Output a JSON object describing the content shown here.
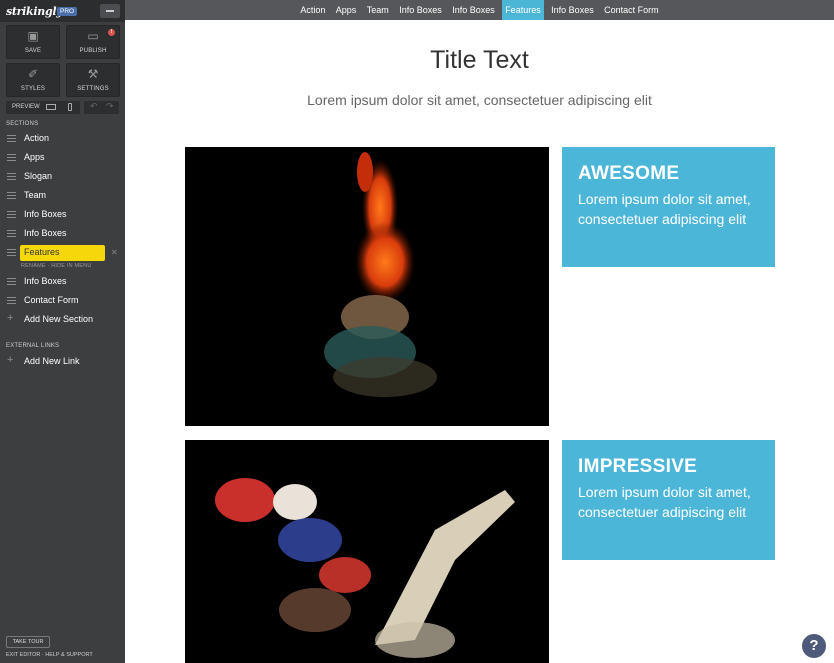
{
  "app": {
    "logo": "strikingly",
    "badge": "PRO"
  },
  "toolbar": {
    "save": "SAVE",
    "publish": "PUBLISH",
    "publish_badge": "!",
    "styles": "STYLES",
    "settings": "SETTINGS",
    "preview": "PREVIEW"
  },
  "sidebar": {
    "sections_heading": "SECTIONS",
    "items": [
      {
        "label": "Action"
      },
      {
        "label": "Apps"
      },
      {
        "label": "Slogan"
      },
      {
        "label": "Team"
      },
      {
        "label": "Info Boxes"
      },
      {
        "label": "Info Boxes"
      },
      {
        "label": "Features",
        "active": true
      },
      {
        "label": "Info Boxes"
      },
      {
        "label": "Contact Form"
      }
    ],
    "item_actions": "RENAME  ·  HIDE IN MENU",
    "add_section": "Add New Section",
    "external_heading": "EXTERNAL LINKS",
    "add_link": "Add New Link",
    "tour": "TAKE TOUR",
    "exit": "EXIT EDITOR · HELP & SUPPORT"
  },
  "topnav": {
    "links": [
      "Action",
      "Apps",
      "Team",
      "Info Boxes",
      "Info Boxes",
      "Features",
      "Info Boxes",
      "Contact Form"
    ],
    "active": "Features"
  },
  "content": {
    "title": "Title Text",
    "subtitle": "Lorem ipsum dolor sit amet, consectetuer adipiscing elit",
    "features": [
      {
        "title": "AWESOME",
        "text": "Lorem ipsum dolor sit amet, consectetuer adipiscing elit"
      },
      {
        "title": "IMPRESSIVE",
        "text": "Lorem ipsum dolor sit amet, consectetuer adipiscing elit"
      }
    ]
  },
  "help": {
    "label": "?"
  },
  "colors": {
    "accent": "#4cb6d9",
    "active_section": "#f5d80b",
    "sidebar": "#3d3e40"
  }
}
